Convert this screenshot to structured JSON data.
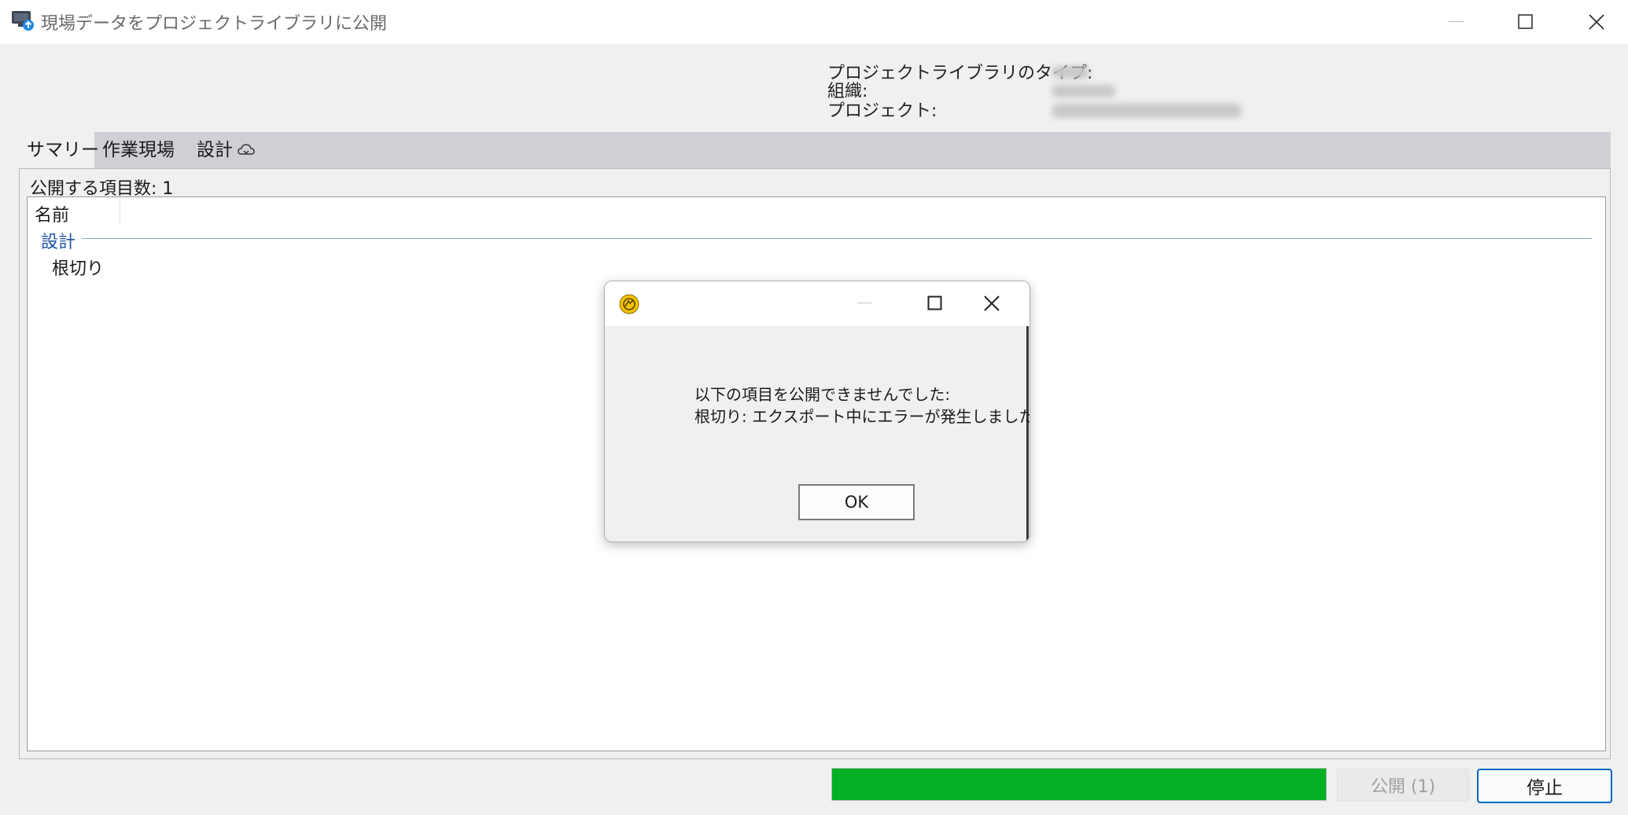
{
  "window": {
    "title": "現場データをプロジェクトライブラリに公開",
    "icons": {
      "app": "monitor-publish-icon",
      "minimize": "minimize-icon",
      "maximize": "maximize-icon",
      "close": "close-icon"
    }
  },
  "info": {
    "labels": [
      "プロジェクトライブラリのタイプ:",
      "組織:",
      "プロジェクト:"
    ]
  },
  "tabs": [
    {
      "label": "サマリー",
      "active": true
    },
    {
      "label": "作業現場",
      "active": false
    },
    {
      "label": "設計",
      "active": false,
      "icon": "cloud-sync-icon"
    }
  ],
  "summary": {
    "count_label": "公開する項目数: 1",
    "column_header": "名前",
    "group": "設計",
    "items": [
      "根切り"
    ]
  },
  "footer": {
    "progress": 1.0,
    "progress_color": "#06b025",
    "publish_label": "公開 (1)",
    "stop_label": "停止"
  },
  "dialog": {
    "icon": "app-logo-icon",
    "message_line1": "以下の項目を公開できませんでした:",
    "message_line2": "根切り: エクスポート中にエラーが発生しました。",
    "ok_label": "OK"
  },
  "colors": {
    "accent": "#0067c0",
    "group_text": "#1f55a8"
  }
}
